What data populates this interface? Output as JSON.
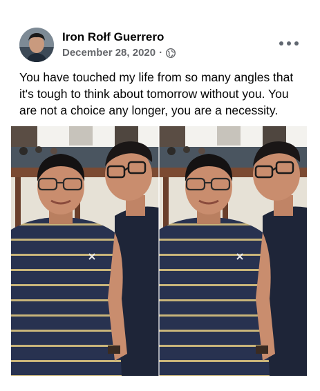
{
  "post": {
    "author": "Iron Rołf Guerrero",
    "date": "December 28, 2020",
    "separator": "·",
    "privacy_icon": "globe-icon",
    "more_icon": "more-options-icon",
    "text": "You have touched my life from so many angles that it's tough to think about tomorrow without you. You are not a choice any longer, you are a necessity."
  },
  "photo": {
    "layout": "mirrored-duplicate",
    "colors": {
      "stripe_shirt": "#283250",
      "stripe": "#c9b57a",
      "dark_shirt": "#1e2538",
      "skin": "#c98d6e",
      "wall": "#e6e1d6",
      "railing": "#7b4a32"
    }
  }
}
